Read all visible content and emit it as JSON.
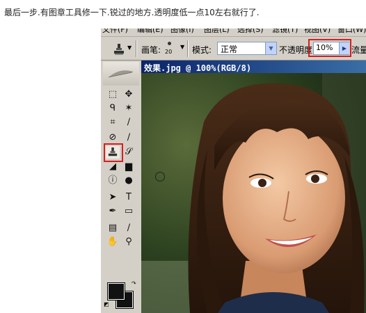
{
  "caption": "最后一步.有图章工具修一下.锐过的地方.透明度低一点10左右就行了.",
  "menubar": [
    "文件(F)",
    "编辑(E)",
    "图像(I)",
    "图层(L)",
    "选择(S)",
    "滤镜(T)",
    "视图(V)",
    "窗口(W)"
  ],
  "options": {
    "tool_icon": "clone-stamp-icon",
    "brush_label": "画笔:",
    "brush_size": "20",
    "mode_label": "模式:",
    "mode_value": "正常",
    "opacity_label": "不透明度:",
    "opacity_value": "10%",
    "flow_label": "流量"
  },
  "document": {
    "title": "效果.jpg @ 100%(RGB/8)"
  },
  "colors": {
    "highlight_red": "#d42020",
    "title_bar": "#0a246a",
    "foreground": "#111111",
    "background": "#111111"
  }
}
